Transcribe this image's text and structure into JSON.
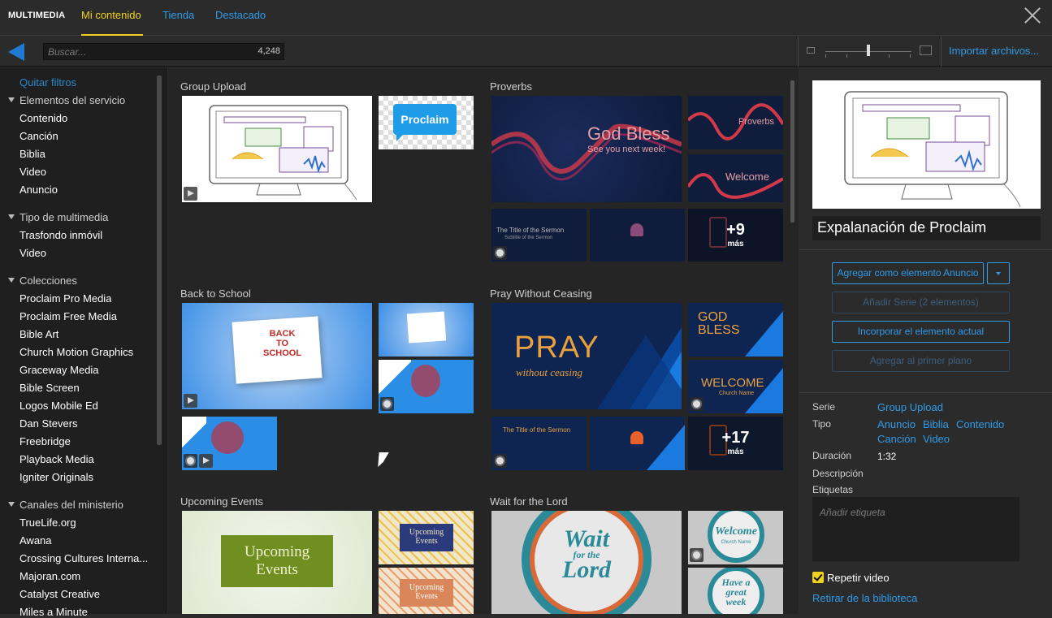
{
  "header": {
    "brand": "MULTIMEDIA",
    "tabs": [
      {
        "label": "Mi contenido",
        "active": true
      },
      {
        "label": "Tienda",
        "active": false
      },
      {
        "label": "Destacado",
        "active": false
      }
    ]
  },
  "toolbar": {
    "search_placeholder": "Buscar...",
    "count": "4,248",
    "import_label": "Importar archivos..."
  },
  "sidebar": {
    "clear_filters": "Quitar filtros",
    "sections": [
      {
        "title": "Elementos del servicio",
        "items": [
          "Contenido",
          "Canción",
          "Biblia",
          "Video",
          "Anuncio"
        ]
      },
      {
        "title": "Tipo de multimedia",
        "items": [
          "Trasfondo inmóvil",
          "Video"
        ]
      },
      {
        "title": "Colecciones",
        "items": [
          "Proclaim Pro Media",
          "Proclaim Free Media",
          "Bible Art",
          "Church Motion Graphics",
          "Graceway Media",
          "Bible Screen",
          "Logos Mobile Ed",
          "Dan Stevers",
          "Freebridge",
          "Playback Media",
          "Igniter Originals"
        ]
      },
      {
        "title": "Canales del ministerio",
        "items": [
          "TrueLife.org",
          "Awana",
          "Crossing Cultures Interna...",
          "Majoran.com",
          "Catalyst Creative",
          "Miles a Minute"
        ]
      }
    ]
  },
  "groups": [
    {
      "title": "Group Upload"
    },
    {
      "title": "Proverbs",
      "more_count": "+9",
      "more_label": "más"
    },
    {
      "title": "Back to School"
    },
    {
      "title": "Pray Without Ceasing",
      "more_count": "+17",
      "more_label": "más"
    },
    {
      "title": "Upcoming Events"
    },
    {
      "title": "Wait for the Lord"
    }
  ],
  "thumb_text": {
    "proclaim": "Proclaim",
    "god_bless": "God Bless",
    "see_you": "See you next week!",
    "proverbs": "Proverbs",
    "welcome": "Welcome",
    "sermon": "The Title of the Sermon",
    "sermon_sub": "Subtitle of the Sermon",
    "pray": "PRAY",
    "without": "without ceasing",
    "god": "GOD",
    "bless": "BLESS",
    "welcome_caps": "WELCOME",
    "church_name": "Church Name",
    "upcoming": "Upcoming",
    "events": "Events",
    "wait": "Wait",
    "for_the": "for the",
    "lord": "Lord",
    "have_a": "Have a",
    "great": "great",
    "week": "week",
    "back": "BACK",
    "to": "TO",
    "school": "SCHOOL"
  },
  "detail": {
    "title": "Expalanación de Proclaim",
    "buttons": {
      "add_announcement": "Agregar como elemento Anuncio",
      "add_series": "Añadir Serie (2 elementos)",
      "incorporate": "Incorporar el elemento actual",
      "foreground": "Agregar al primer plano"
    },
    "labels": {
      "serie": "Serie",
      "tipo": "Tipo",
      "duracion": "Duración",
      "descripcion": "Descripción",
      "etiquetas": "Etiquetas"
    },
    "serie_value": "Group Upload",
    "tipo_values": [
      "Anuncio",
      "Biblia",
      "Contenido",
      "Canción",
      "Video"
    ],
    "duracion_value": "1:32",
    "tag_placeholder": "Añadir etiqueta",
    "repeat_label": "Repetir video",
    "remove_label": "Retirar de la biblioteca"
  },
  "colors": {
    "accent_blue": "#2f9be8",
    "active_yellow": "#f0d020",
    "proverbs_bg": "#0e1a3a",
    "pray_bg": "#0d2550"
  }
}
